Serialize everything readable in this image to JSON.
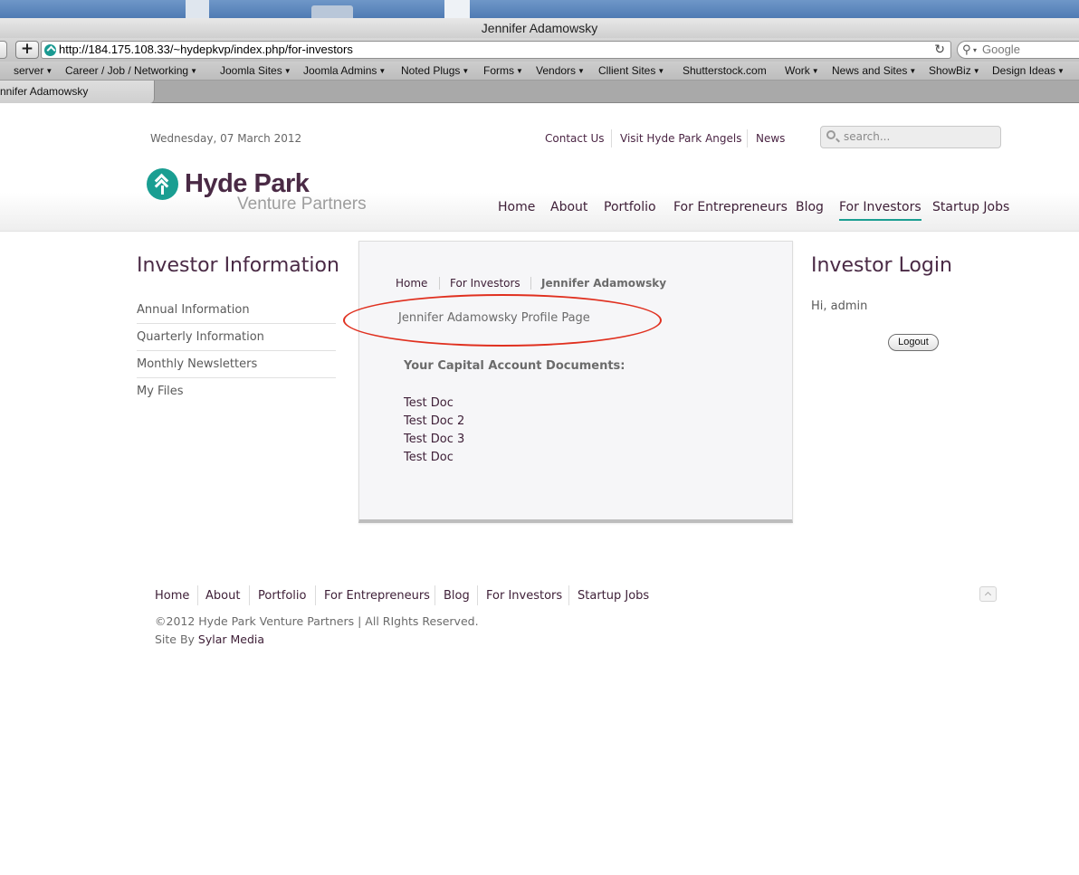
{
  "browser": {
    "window_title": "Jennifer Adamowsky",
    "url": "http://184.175.108.33/~hydepkvp/index.php/for-investors",
    "search_placeholder": "Google",
    "bookmarks": [
      "server",
      "Career / Job / Networking",
      "Joomla Sites",
      "Joomla Admins",
      "Noted Plugs",
      "Forms",
      "Vendors",
      "Cllient Sites",
      "Shutterstock.com",
      "Work",
      "News and Sites",
      "ShowBiz",
      "Design Ideas"
    ],
    "tab_label": "nnifer Adamowsky"
  },
  "header": {
    "date": "Wednesday, 07 March 2012",
    "top_links": [
      "Contact Us",
      "Visit Hyde Park Angels",
      "News"
    ],
    "search_placeholder": "search...",
    "logo_name": "Hyde Park",
    "logo_sub": "Venture Partners",
    "nav": [
      "Home",
      "About",
      "Portfolio",
      "For Entrepreneurs",
      "Blog",
      "For Investors",
      "Startup Jobs"
    ],
    "active_nav": "For Investors"
  },
  "left_sidebar": {
    "title": "Investor Information",
    "items": [
      "Annual Information",
      "Quarterly Information",
      "Monthly Newsletters",
      "My Files"
    ]
  },
  "main": {
    "breadcrumb": [
      "Home",
      "For Investors",
      "Jennifer Adamowsky"
    ],
    "page_title": "Jennifer Adamowsky Profile Page",
    "docs_heading": "Your Capital Account Documents:",
    "documents": [
      "Test Doc",
      "Test Doc 2",
      "Test Doc 3",
      "Test Doc"
    ]
  },
  "right_sidebar": {
    "title": "Investor Login",
    "greeting": "Hi, admin",
    "logout_label": "Logout"
  },
  "footer": {
    "nav": [
      "Home",
      "About",
      "Portfolio",
      "For Entrepreneurs",
      "Blog",
      "For Investors",
      "Startup Jobs"
    ],
    "copyright": "©2012 Hyde Park Venture Partners | All RIghts Reserved.",
    "site_by_label": "Site By ",
    "site_by_link": "Sylar Media"
  },
  "colors": {
    "brand_teal": "#1a9e92",
    "brand_plum": "#4a2a45",
    "annotation_red": "#e0301f"
  }
}
